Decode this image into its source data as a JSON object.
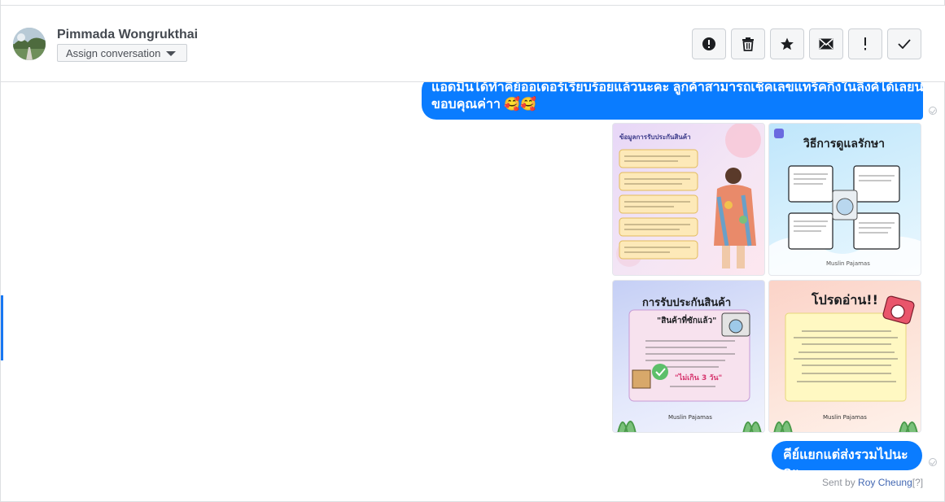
{
  "header": {
    "contact_name": "Pimmada Wongrukthai",
    "assign_label": "Assign conversation",
    "actions": [
      {
        "name": "spam-icon",
        "label": "Mark as spam"
      },
      {
        "name": "trash-icon",
        "label": "Delete"
      },
      {
        "name": "star-icon",
        "label": "Star"
      },
      {
        "name": "envelope-icon",
        "label": "Mark as unread"
      },
      {
        "name": "exclamation-icon",
        "label": "Follow up"
      },
      {
        "name": "check-icon",
        "label": "Done"
      }
    ]
  },
  "messages": {
    "first": {
      "line1": "แอดมินได้ทำคีย์ออเดอร์เรียบร้อยแล้วนะคะ ลูกค้าสามารถเช็คเลขแทร็คกิ้งในลิงค์ได้เลยนะคะ",
      "line2": "ขอบคุณค่าา 🥰🥰"
    },
    "image_tiles": [
      {
        "title": "ข้อมูลการรับประกันสินค้า"
      },
      {
        "title": "วิธีการดูแลรักษา"
      },
      {
        "title": "การรับประกันสินค้า",
        "subtitle": "\"สินค้าที่ซักแล้ว\"",
        "emph": "\"ไม่เกิน 3 วัน\"",
        "brand": "Muslin Pajamas"
      },
      {
        "title": "โปรดอ่าน!!",
        "brand": "Muslin Pajamas"
      }
    ],
    "second": {
      "text": "คีย์แยกแต่ส่งรวมไปนะคะ"
    },
    "sent_by_prefix": "Sent by ",
    "sent_by_name": "Roy Cheung",
    "sent_by_suffix": "[?]"
  },
  "colors": {
    "accent": "#0a7cff",
    "border": "#dddfe2"
  }
}
